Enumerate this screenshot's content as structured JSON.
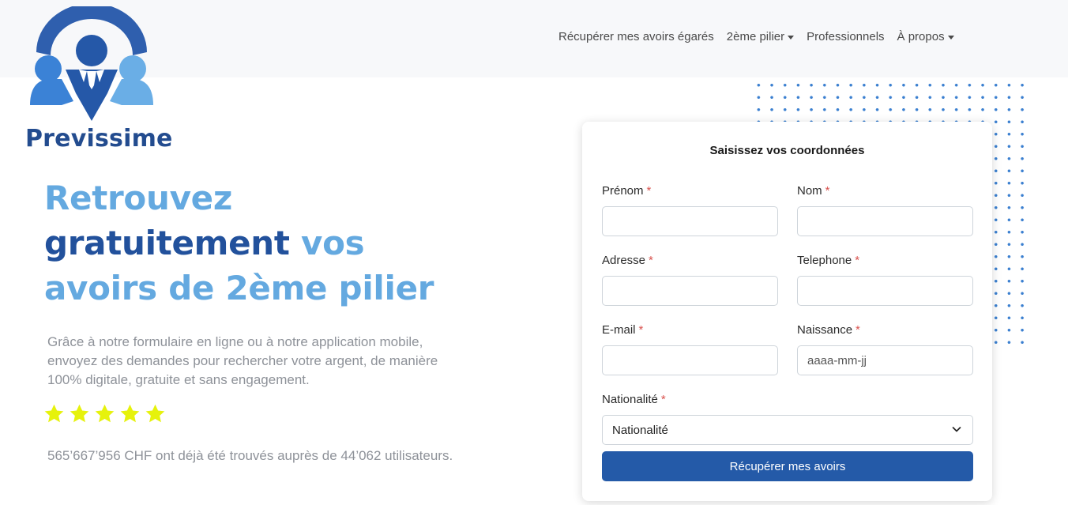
{
  "brand": {
    "name": "Previssime"
  },
  "nav": {
    "items": [
      {
        "label": "Récupérer mes avoirs égarés",
        "dropdown": false
      },
      {
        "label": "2ème pilier",
        "dropdown": true
      },
      {
        "label": "Professionnels",
        "dropdown": false
      },
      {
        "label": "À propos",
        "dropdown": true
      }
    ]
  },
  "hero": {
    "title_part1": "Retrouvez",
    "title_part2": "gratuitement",
    "title_part3": "vos",
    "title_part4": "avoirs de 2ème pilier",
    "description": "Grâce à notre formulaire en ligne ou à notre application mobile, envoyez des demandes pour rechercher votre argent, de manière 100% digitale, gratuite et sans engagement.",
    "rating": 5,
    "stats": "565’667’956 CHF ont déjà été trouvés auprès de 44’062 utilisateurs."
  },
  "form": {
    "title": "Saisissez vos coordonnées",
    "required_mark": "*",
    "fields": {
      "prenom": {
        "label": "Prénom",
        "value": "",
        "placeholder": ""
      },
      "nom": {
        "label": "Nom",
        "value": "",
        "placeholder": ""
      },
      "adresse": {
        "label": "Adresse",
        "value": "",
        "placeholder": ""
      },
      "telephone": {
        "label": "Telephone",
        "value": "",
        "placeholder": ""
      },
      "email": {
        "label": "E-mail",
        "value": "",
        "placeholder": ""
      },
      "naissance": {
        "label": "Naissance",
        "value": "",
        "placeholder": "aaaa-mm-jj"
      },
      "nationalite": {
        "label": "Nationalité",
        "selected": "Nationalité"
      }
    },
    "submit_label": "Récupérer mes avoirs"
  },
  "colors": {
    "accent_light": "#64a9e0",
    "accent_dark": "#22519c",
    "button": "#245aa8",
    "stars": "#e6f20c",
    "required": "#d9534f"
  }
}
